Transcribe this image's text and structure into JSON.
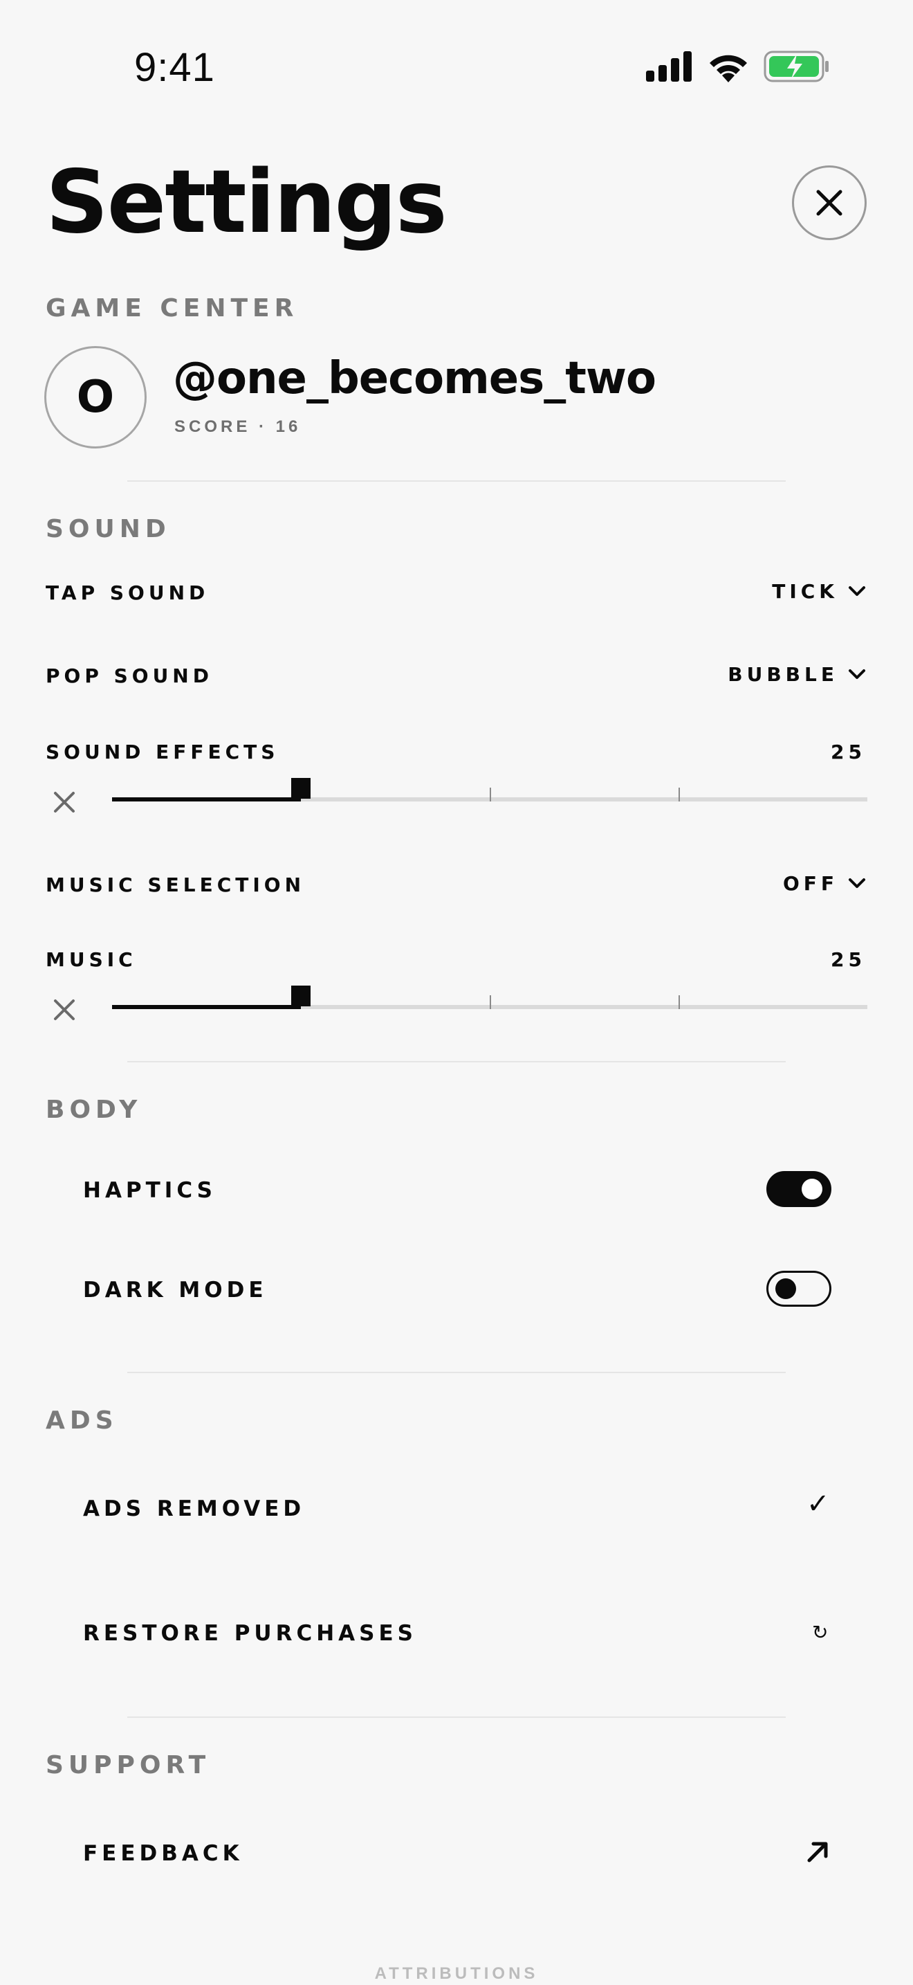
{
  "status_bar": {
    "time": "9:41"
  },
  "header": {
    "title": "Settings"
  },
  "game_center": {
    "heading": "GAME CENTER",
    "avatar_initial": "O",
    "username": "@one_becomes_two",
    "score": "SCORE · 16"
  },
  "sound": {
    "heading": "SOUND",
    "tap_sound": {
      "label": "TAP SOUND",
      "value": "TICK"
    },
    "pop_sound": {
      "label": "POP SOUND",
      "value": "BUBBLE"
    },
    "sound_effects": {
      "label": "SOUND EFFECTS",
      "value": "25",
      "level": 25
    },
    "music_selection": {
      "label": "MUSIC SELECTION",
      "value": "OFF"
    },
    "music": {
      "label": "MUSIC",
      "value": "25",
      "level": 25
    }
  },
  "body_section": {
    "heading": "BODY",
    "haptics": {
      "label": "HAPTICS",
      "on": true
    },
    "dark_mode": {
      "label": "DARK MODE",
      "on": false
    }
  },
  "ads": {
    "heading": "ADS",
    "ads_removed": {
      "label": "ADS REMOVED",
      "icon": "checkmark-icon",
      "glyph": "✓"
    },
    "restore": {
      "label": "RESTORE PURCHASES",
      "icon": "refresh-icon",
      "glyph": "↻"
    }
  },
  "support": {
    "heading": "SUPPORT",
    "feedback": {
      "label": "FEEDBACK",
      "icon": "arrow-up-right-icon"
    }
  },
  "footer": {
    "attributions": "ATTRIBUTIONS"
  },
  "colors": {
    "text": "#0b0b0b",
    "muted": "#7a7a7a",
    "background": "#f7f7f7",
    "battery": "#34c759"
  }
}
